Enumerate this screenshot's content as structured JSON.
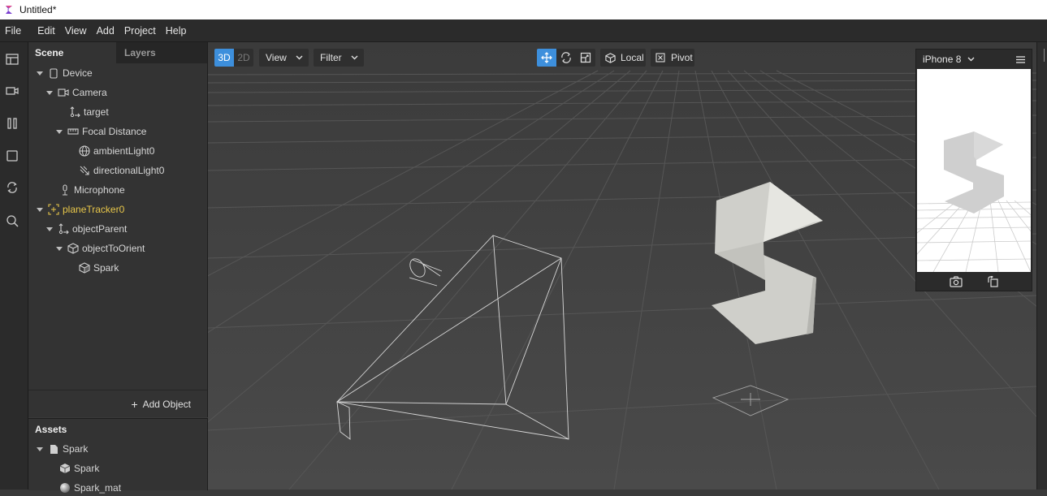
{
  "window": {
    "title": "Untitled*"
  },
  "menu": [
    "File",
    "Edit",
    "View",
    "Add",
    "Project",
    "Help"
  ],
  "left_toolbar": [
    "layout-icon",
    "video-icon",
    "pause-icon",
    "square-icon",
    "sync-icon",
    "search-icon"
  ],
  "scene_panel": {
    "tabs": [
      "Scene",
      "Layers"
    ],
    "tree": [
      {
        "label": "Device",
        "icon": "device-icon"
      },
      {
        "label": "Camera",
        "icon": "camera-icon"
      },
      {
        "label": "target",
        "icon": "target-icon"
      },
      {
        "label": "Focal Distance",
        "icon": "ruler-icon"
      },
      {
        "label": "ambientLight0",
        "icon": "globe-light-icon"
      },
      {
        "label": "directionalLight0",
        "icon": "directional-light-icon"
      },
      {
        "label": "Microphone",
        "icon": "microphone-icon"
      },
      {
        "label": "planeTracker0",
        "icon": "plane-tracker-icon"
      },
      {
        "label": "objectParent",
        "icon": "null-object-icon"
      },
      {
        "label": "objectToOrient",
        "icon": "cube-outline-icon"
      },
      {
        "label": "Spark",
        "icon": "mesh-icon"
      }
    ],
    "add_object": "Add Object"
  },
  "assets_panel": {
    "title": "Assets",
    "items": [
      {
        "label": "Spark",
        "icon": "file-icon"
      },
      {
        "label": "Spark",
        "icon": "mesh-icon"
      },
      {
        "label": "Spark_mat",
        "icon": "material-sphere-icon"
      }
    ]
  },
  "viewport_toolbar": {
    "mode_3d": "3D",
    "mode_2d": "2D",
    "view": "View",
    "filter": "Filter",
    "local": "Local",
    "pivot": "Pivot"
  },
  "simulator": {
    "device": "iPhone 8"
  },
  "colors": {
    "accent": "#3d8fdc",
    "highlight": "#e8c74a",
    "panel": "#333333"
  }
}
